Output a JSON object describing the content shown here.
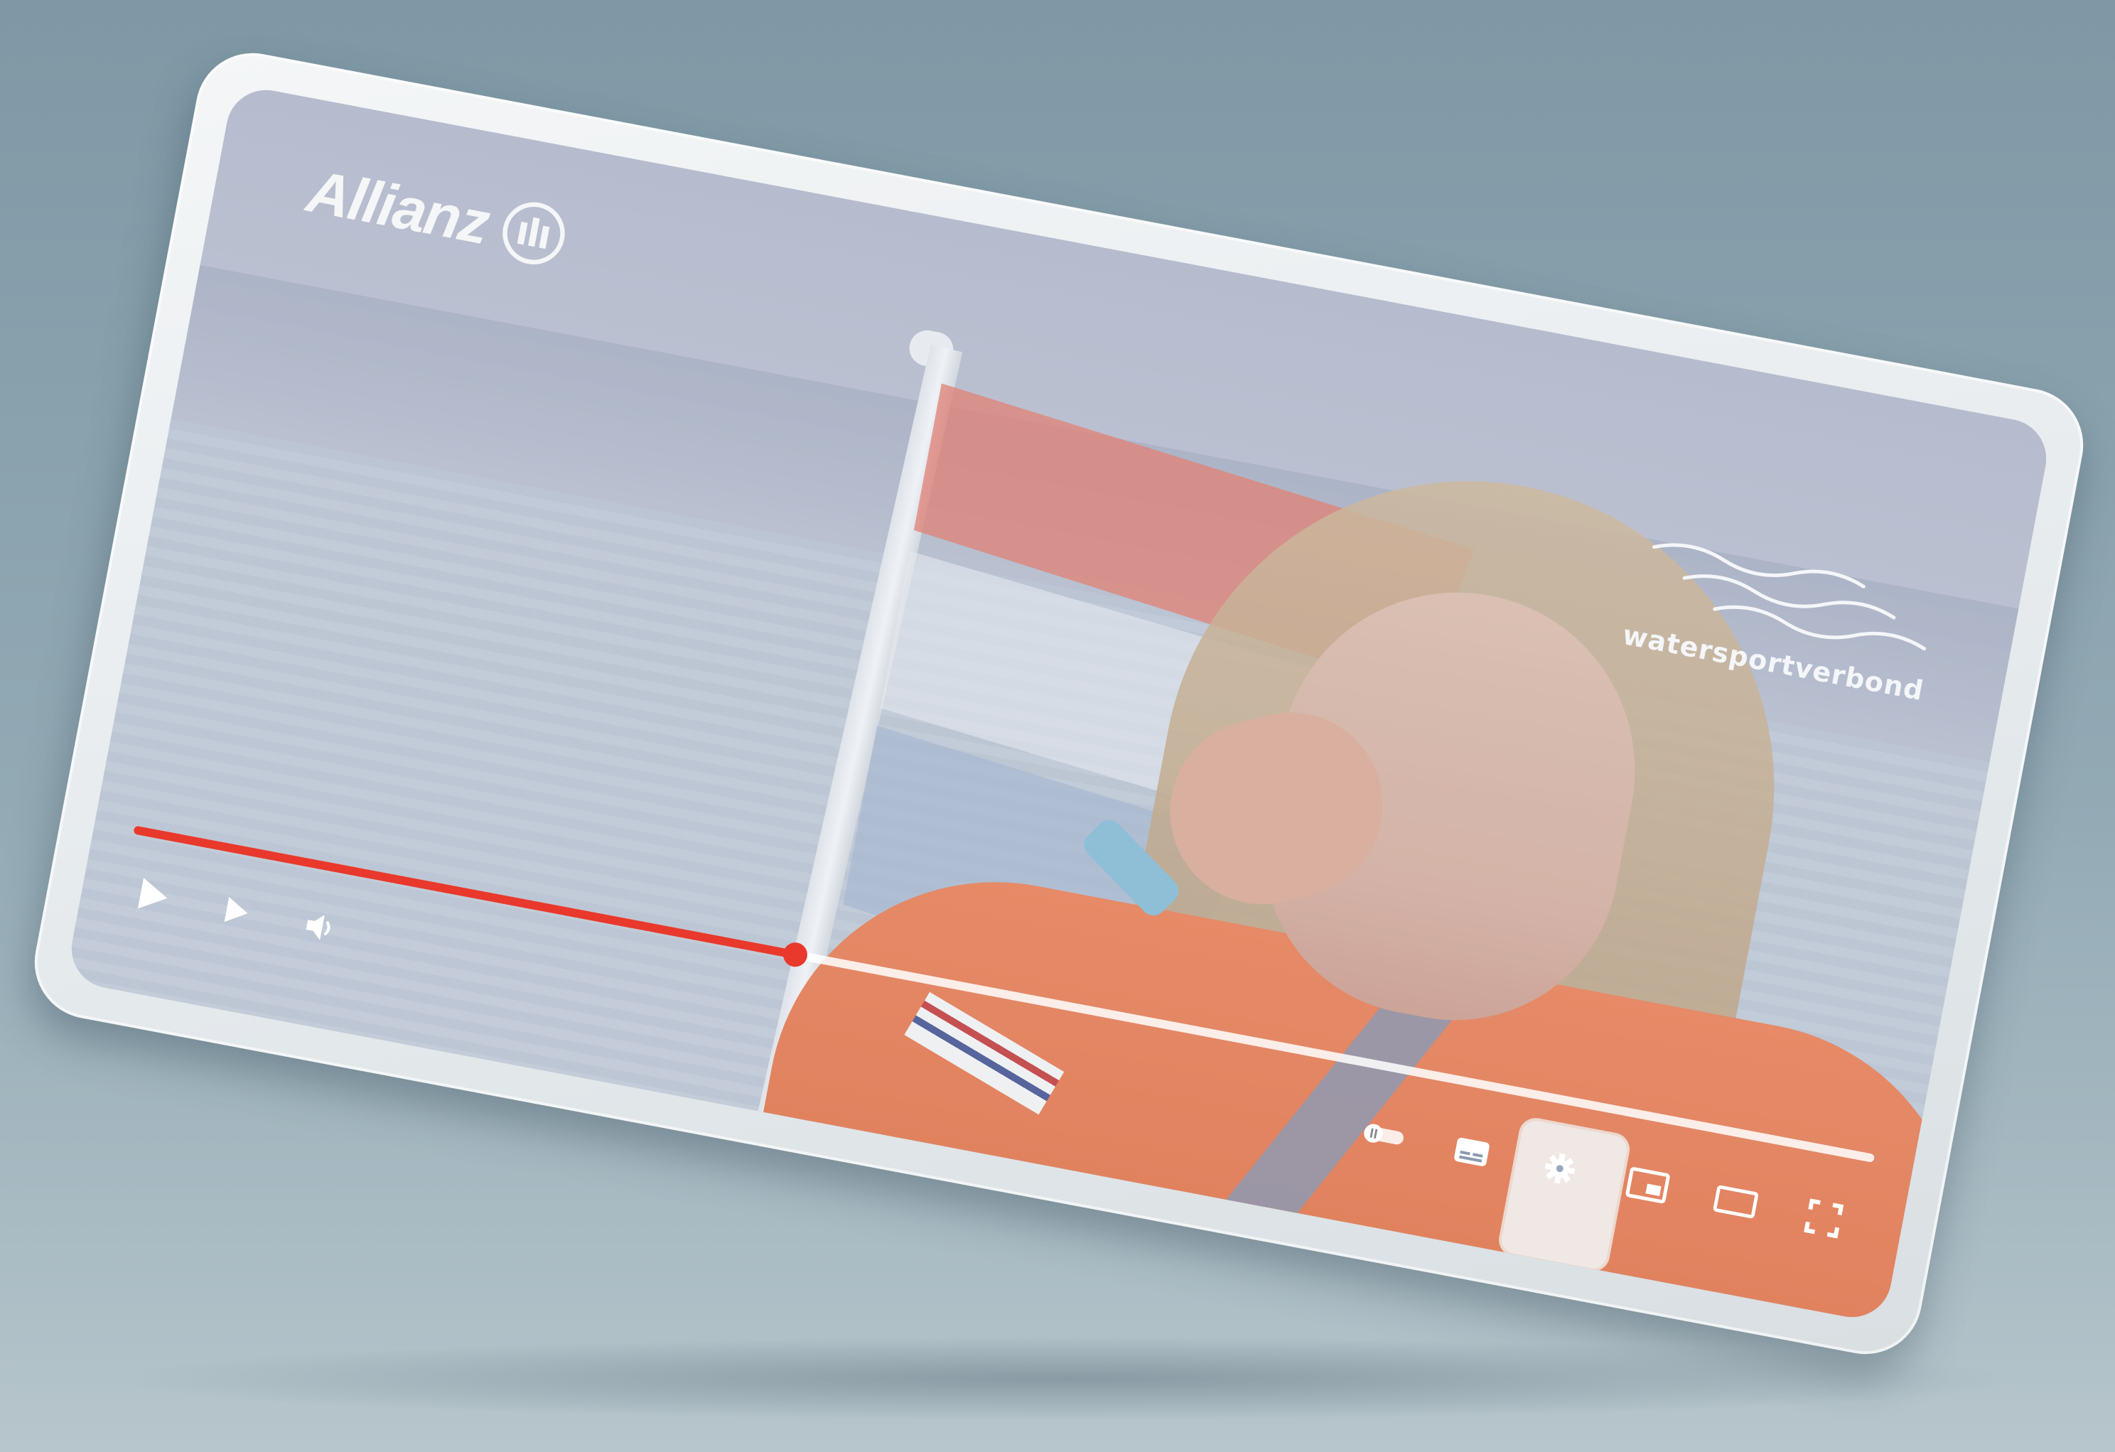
{
  "brand_left": {
    "name": "Allianz"
  },
  "brand_right": {
    "name": "watersportverbond"
  },
  "player": {
    "progress_fraction": 0.38,
    "accent_color": "#e8392c",
    "controls_left": [
      "play-icon",
      "next-icon",
      "volume-icon"
    ],
    "controls_right": [
      "autoplay-toggle-icon",
      "subtitles-icon",
      "settings-gear-icon",
      "miniplayer-icon",
      "theater-mode-icon",
      "fullscreen-icon"
    ]
  }
}
